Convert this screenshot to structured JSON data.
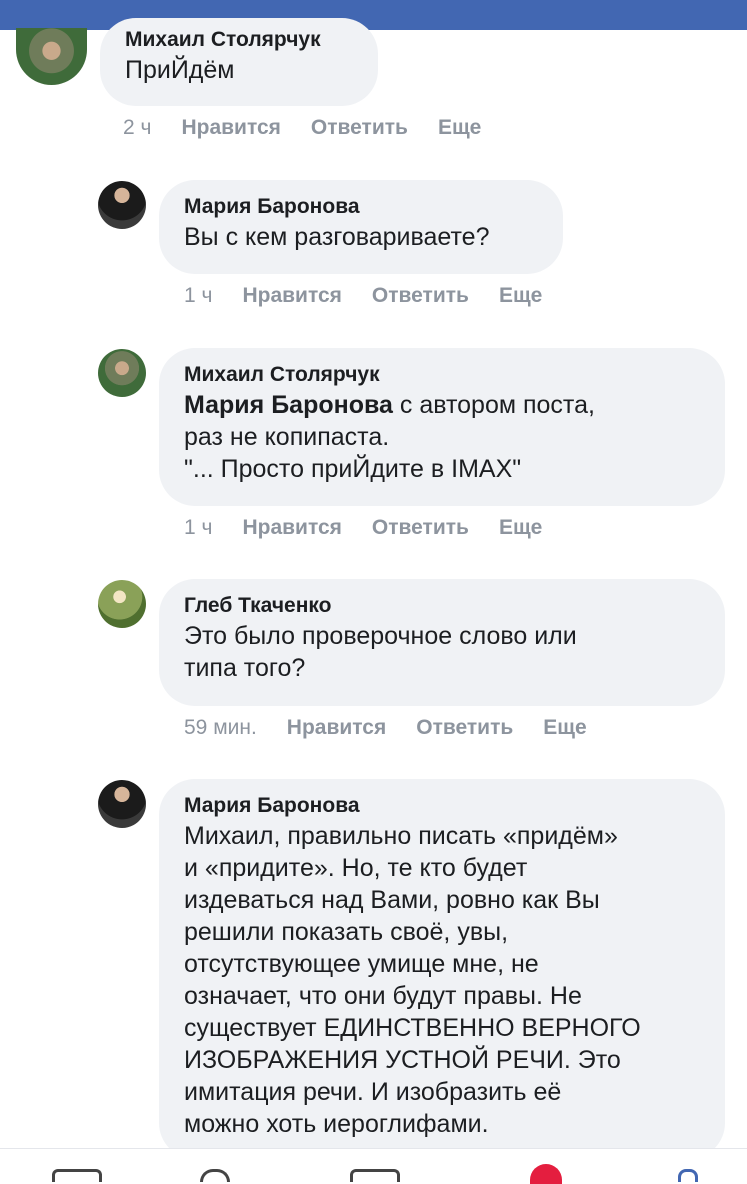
{
  "comments": [
    {
      "author": "Михаил Столярчук",
      "text": "ПриЙдём",
      "time": "2 ч",
      "like": "Нравится",
      "reply": "Ответить",
      "more": "Еще"
    },
    {
      "author": "Мария Баронова",
      "text": "Вы с кем разговариваете?",
      "time": "1 ч",
      "like": "Нравится",
      "reply": "Ответить",
      "more": "Еще"
    },
    {
      "author": "Михаил Столярчук",
      "mention": "Мария Баронова",
      "text": " с автором поста,\nраз не копипаста.\n\"... Просто приЙдите в IMAX\"",
      "time": "1 ч",
      "like": "Нравится",
      "reply": "Ответить",
      "more": "Еще"
    },
    {
      "author": "Глеб Ткаченко",
      "text": "Это было проверочное слово или\nтипа того?",
      "time": "59 мин.",
      "like": "Нравится",
      "reply": "Ответить",
      "more": "Еще"
    },
    {
      "author": "Мария Баронова",
      "text": "Михаил, правильно писать «придём»\nи «придите». Но, те кто будет\nиздеваться над Вами, ровно как Вы\nрешили показать своё, увы,\nотсутствующее умище мне, не\nозначает, что они будут правы. Не\nсуществует ЕДИНСТВЕННО ВЕРНОГО\nИЗОБРАЖЕНИЯ УСТНОЙ РЕЧИ. Это\nимитация речи. И изобразить её\nможно хоть иероглифами."
    }
  ],
  "colors": {
    "header": "#4267b2",
    "bubble": "#f0f2f5",
    "meta": "#8d949e",
    "notification": "#e41e3f"
  },
  "icons": [
    "avatar",
    "home-tab-icon",
    "search-tab-icon",
    "video-tab-icon",
    "notifications-tab-icon",
    "menu-tab-icon"
  ]
}
